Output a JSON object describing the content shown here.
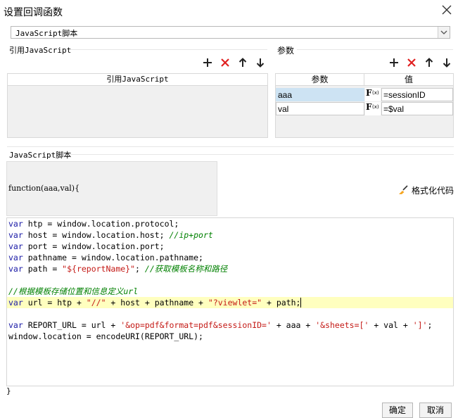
{
  "window": {
    "title": "设置回调函数"
  },
  "script_type": {
    "selected": "JavaScript脚本"
  },
  "ref_js": {
    "section_label": "引用JavaScript",
    "column_header": "引用JavaScript",
    "tools": [
      "add-icon",
      "delete-icon",
      "move-up-icon",
      "move-down-icon"
    ]
  },
  "params": {
    "section_label": "参数",
    "col_param": "参数",
    "col_value": "值",
    "rows": [
      {
        "name": "aaa",
        "value": "=sessionID"
      },
      {
        "name": "val",
        "value": "=$val"
      }
    ],
    "fx_label": "F"
  },
  "script": {
    "section_label": "JavaScript脚本",
    "signature": "function(aaa,val){",
    "format_label": "格式化代码",
    "closing": "}"
  },
  "buttons": {
    "ok": "确定",
    "cancel": "取消"
  },
  "colors": {
    "keyword": "#1a1aa6",
    "string": "#c41a16",
    "comment": "#008000",
    "highlight": "#ffffbf",
    "delete": "#e02020"
  }
}
